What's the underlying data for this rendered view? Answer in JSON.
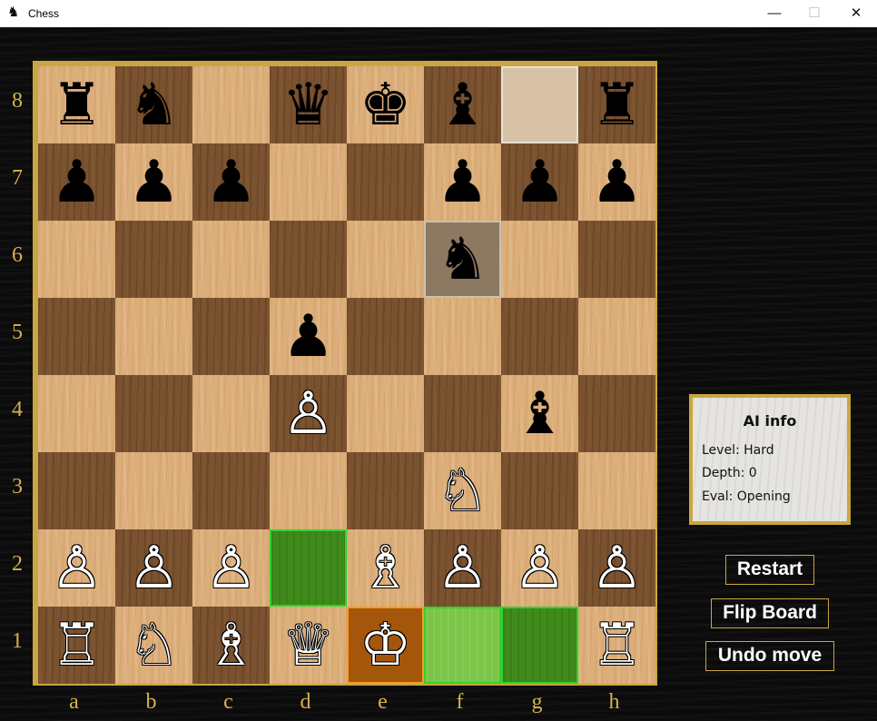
{
  "window": {
    "title": "Chess",
    "app_icon": "chess-knight-icon",
    "minimize_glyph": "—",
    "maximize_glyph": "☐",
    "close_glyph": "✕"
  },
  "board": {
    "files": [
      "a",
      "b",
      "c",
      "d",
      "e",
      "f",
      "g",
      "h"
    ],
    "ranks": [
      "8",
      "7",
      "6",
      "5",
      "4",
      "3",
      "2",
      "1"
    ],
    "pieces": [
      {
        "square": "a8",
        "glyph": "♜",
        "color": "black",
        "name": "rook"
      },
      {
        "square": "b8",
        "glyph": "♞",
        "color": "black",
        "name": "knight"
      },
      {
        "square": "d8",
        "glyph": "♛",
        "color": "black",
        "name": "queen"
      },
      {
        "square": "e8",
        "glyph": "♚",
        "color": "black",
        "name": "king"
      },
      {
        "square": "f8",
        "glyph": "♝",
        "color": "black",
        "name": "bishop"
      },
      {
        "square": "h8",
        "glyph": "♜",
        "color": "black",
        "name": "rook"
      },
      {
        "square": "a7",
        "glyph": "♟",
        "color": "black",
        "name": "pawn"
      },
      {
        "square": "b7",
        "glyph": "♟",
        "color": "black",
        "name": "pawn"
      },
      {
        "square": "c7",
        "glyph": "♟",
        "color": "black",
        "name": "pawn"
      },
      {
        "square": "f7",
        "glyph": "♟",
        "color": "black",
        "name": "pawn"
      },
      {
        "square": "g7",
        "glyph": "♟",
        "color": "black",
        "name": "pawn"
      },
      {
        "square": "h7",
        "glyph": "♟",
        "color": "black",
        "name": "pawn"
      },
      {
        "square": "f6",
        "glyph": "♞",
        "color": "black",
        "name": "knight"
      },
      {
        "square": "d5",
        "glyph": "♟",
        "color": "black",
        "name": "pawn"
      },
      {
        "square": "d4",
        "glyph": "♙",
        "color": "white",
        "name": "pawn"
      },
      {
        "square": "g4",
        "glyph": "♝",
        "color": "black",
        "name": "bishop"
      },
      {
        "square": "f3",
        "glyph": "♘",
        "color": "white",
        "name": "knight"
      },
      {
        "square": "a2",
        "glyph": "♙",
        "color": "white",
        "name": "pawn"
      },
      {
        "square": "b2",
        "glyph": "♙",
        "color": "white",
        "name": "pawn"
      },
      {
        "square": "c2",
        "glyph": "♙",
        "color": "white",
        "name": "pawn"
      },
      {
        "square": "e2",
        "glyph": "♗",
        "color": "white",
        "name": "bishop"
      },
      {
        "square": "f2",
        "glyph": "♙",
        "color": "white",
        "name": "pawn"
      },
      {
        "square": "g2",
        "glyph": "♙",
        "color": "white",
        "name": "pawn"
      },
      {
        "square": "h2",
        "glyph": "♙",
        "color": "white",
        "name": "pawn"
      },
      {
        "square": "a1",
        "glyph": "♖",
        "color": "white",
        "name": "rook"
      },
      {
        "square": "b1",
        "glyph": "♘",
        "color": "white",
        "name": "knight"
      },
      {
        "square": "c1",
        "glyph": "♗",
        "color": "white",
        "name": "bishop"
      },
      {
        "square": "d1",
        "glyph": "♕",
        "color": "white",
        "name": "queen"
      },
      {
        "square": "e1",
        "glyph": "♔",
        "color": "white",
        "name": "king"
      },
      {
        "square": "h1",
        "glyph": "♖",
        "color": "white",
        "name": "rook"
      }
    ],
    "highlights": {
      "last_move_from": "g8",
      "last_move_to": "f6",
      "selected": "e1",
      "legal_moves": [
        "d2",
        "f1",
        "g1"
      ]
    },
    "colors": {
      "frame": "#caa640",
      "label": "#d8b24e",
      "move_border": "#2ed42e",
      "selected_border": "#ff9a1e"
    }
  },
  "ai_info": {
    "title": "AI info",
    "level": "Level: Hard",
    "depth": "Depth: 0",
    "eval": "Eval: Opening"
  },
  "buttons": {
    "restart": "Restart",
    "flip_board": "Flip Board",
    "undo_move": "Undo move"
  }
}
